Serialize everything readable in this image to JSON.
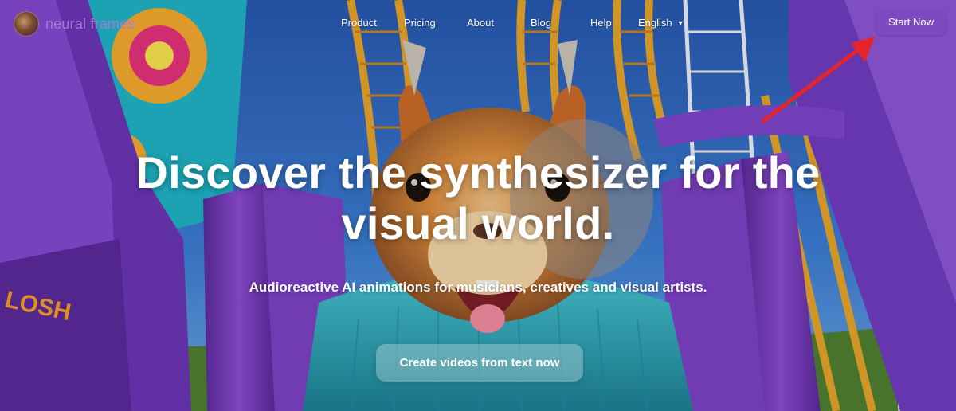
{
  "brand": {
    "name": "neural frames",
    "color": "#a97ad9"
  },
  "nav": {
    "items": [
      {
        "label": "Product"
      },
      {
        "label": "Pricing"
      },
      {
        "label": "About"
      },
      {
        "label": "Blog"
      },
      {
        "label": "Help"
      }
    ],
    "language": {
      "label": "English",
      "icon": "caret-down-icon"
    },
    "cta": {
      "label": "Start Now",
      "color": "#7d4abe"
    }
  },
  "annotation": {
    "icon": "red-arrow-icon",
    "color": "#e8242b"
  },
  "hero": {
    "headline_line1": "Discover the synthesizer for the",
    "headline_line2": "visual world.",
    "subheadline": "Audioreactive AI animations for musicians, creatives and visual artists.",
    "cta_label": "Create videos from text now"
  },
  "colors": {
    "sky": "#2f64b8",
    "purple": "#7a3fc0",
    "track_orange": "#e3a12a",
    "squirrel": "#cf7a2e",
    "sweater": "#2aa6b8"
  }
}
